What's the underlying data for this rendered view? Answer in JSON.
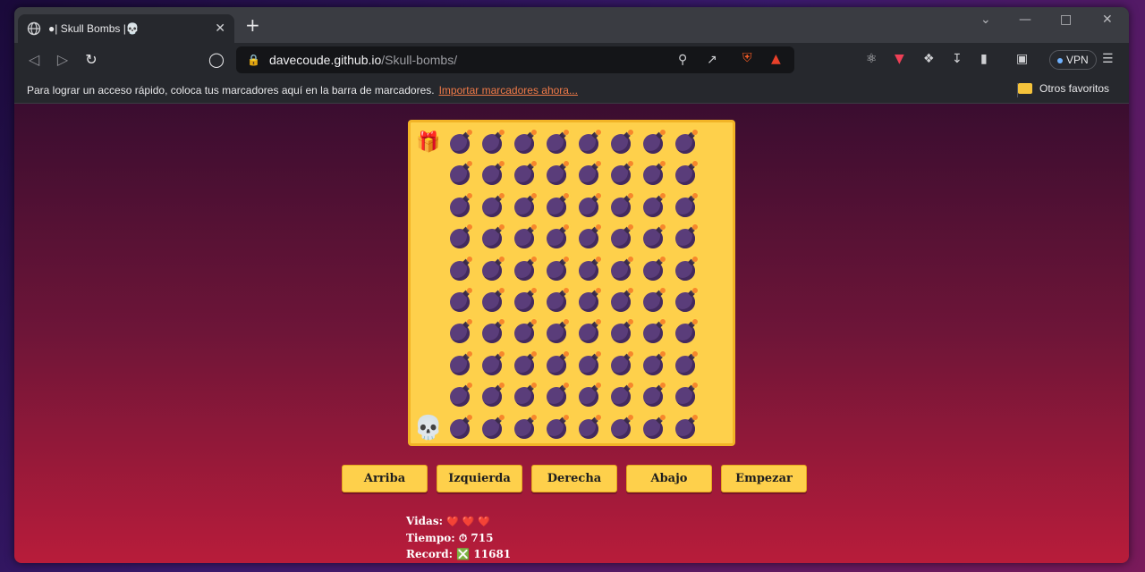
{
  "browser": {
    "tab_title": "●| Skull Bombs |💀",
    "tab_close": "✕",
    "new_tab": "+",
    "url_host": "davecoude.github.io",
    "url_path": "/Skull-bombs/",
    "vpn_label": "VPN",
    "bookmarks_text": "Para lograr un acceso rápido, coloca tus marcadores aquí en la barra de marcadores.",
    "bookmarks_link": "Importar marcadores ahora...",
    "other_favorites": "Otros favoritos"
  },
  "game": {
    "rows": 10,
    "cols": 9,
    "gift_icon": "🎁",
    "skull_icon": "💀",
    "buttons": {
      "up": "Arriba",
      "left": "Izquierda",
      "right": "Derecha",
      "down": "Abajo",
      "start": "Empezar"
    },
    "stats": {
      "lives_label": "Vidas:",
      "lives_icons": "❤️ ❤️ ❤️",
      "time_label": "Tiempo:",
      "time_icon": "⏱",
      "time_value": "715",
      "record_label": "Record:",
      "record_icon": "❎",
      "record_value": "11681"
    }
  }
}
